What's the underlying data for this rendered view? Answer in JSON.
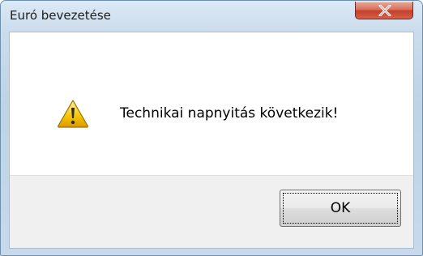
{
  "window": {
    "title": "Euró bevezetése",
    "close_icon": "close-icon"
  },
  "dialog": {
    "icon": "warning-icon",
    "message": "Technikai napnyitás következik!",
    "ok_label": "OK"
  },
  "colors": {
    "close_button": "#c4402a",
    "warning_yellow": "#f3c400",
    "frame": "#bfd3e7"
  }
}
